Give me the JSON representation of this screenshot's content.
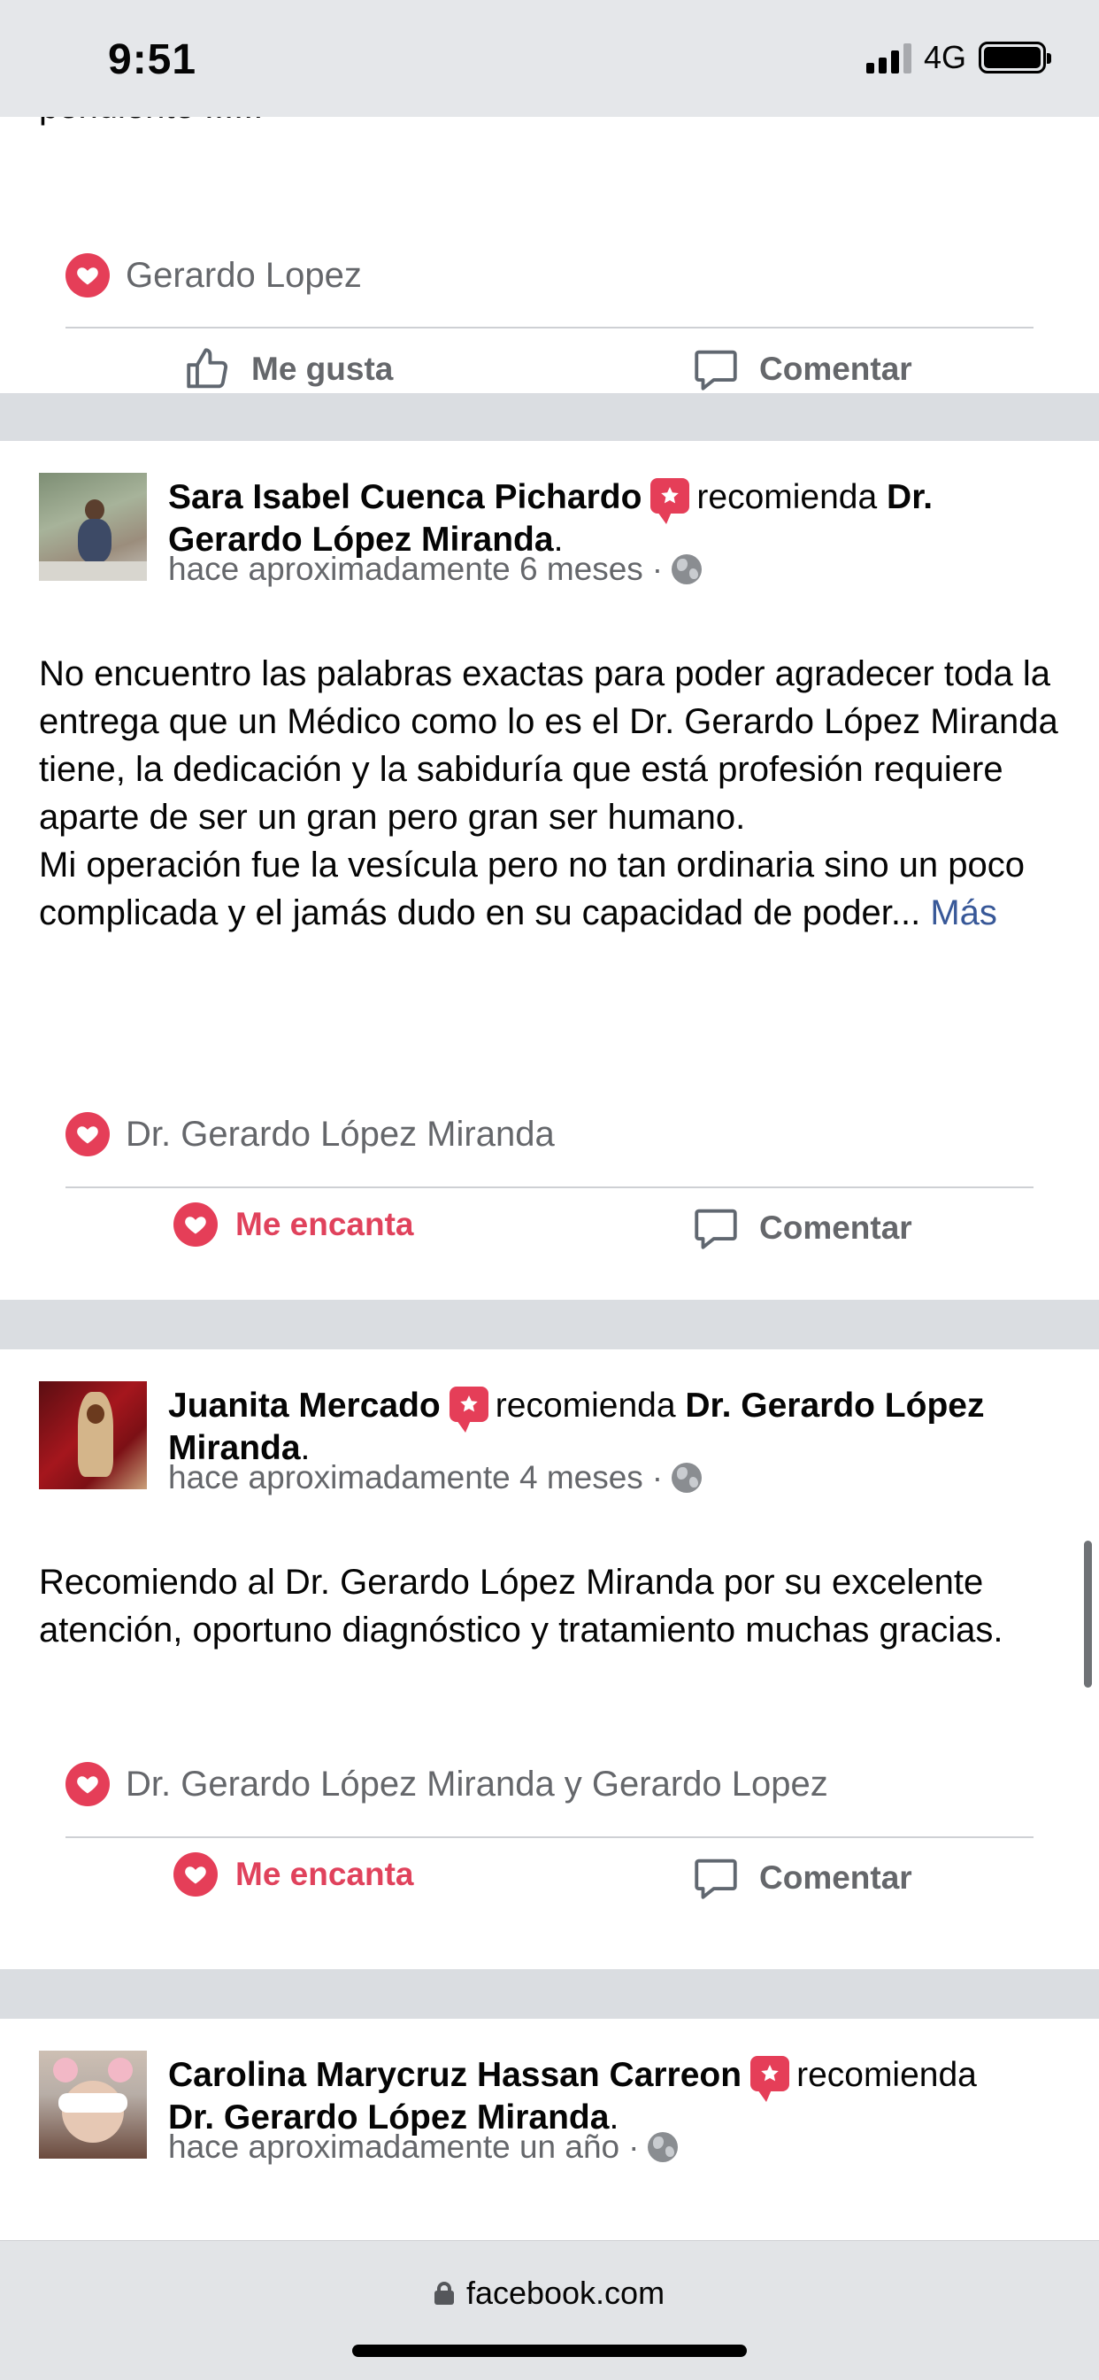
{
  "status_bar": {
    "time": "9:51",
    "network": "4G"
  },
  "posts": [
    {
      "truncated_text": "pendiente !!!!!!",
      "reactions_text": "Gerardo Lopez",
      "like_label": "Me gusta",
      "comment_label": "Comentar"
    },
    {
      "author": "Sara Isabel Cuenca Pichardo",
      "recommends_word": "recomienda",
      "page": "Dr. Gerardo López Miranda",
      "time": "hace aproximadamente 6 meses",
      "body": "No encuentro las palabras exactas para poder agradecer toda la entrega que un Médico como lo es el Dr. Gerardo López Miranda tiene, la dedicación y la sabiduría que está profesión requiere aparte de ser un gran pero gran ser humano.\nMi operación fue la vesícula pero no tan ordinaria sino un poco complicada y el jamás dudo en su capacidad de poder...",
      "more_label": "Más",
      "reactions_text": "Dr. Gerardo López Miranda",
      "love_label": "Me encanta",
      "comment_label": "Comentar"
    },
    {
      "author": "Juanita Mercado",
      "recommends_word": "recomienda",
      "page": "Dr. Gerardo López Miranda",
      "time": "hace aproximadamente 4 meses",
      "body": "Recomiendo al Dr. Gerardo López Miranda por su excelente atención, oportuno diagnóstico y tratamiento muchas gracias.",
      "reactions_text": "Dr. Gerardo López Miranda y Gerardo Lopez",
      "love_label": "Me encanta",
      "comment_label": "Comentar"
    },
    {
      "author": "Carolina Marycruz Hassan Carreon",
      "recommends_word": "recomienda",
      "page": "Dr. Gerardo López Miranda",
      "time": "hace aproximadamente un año"
    }
  ],
  "url_bar": {
    "domain": "facebook.com"
  },
  "colors": {
    "love": "#e53e58",
    "secondary_text": "#65676b",
    "link": "#385898",
    "feed_bg": "#dadde1"
  }
}
